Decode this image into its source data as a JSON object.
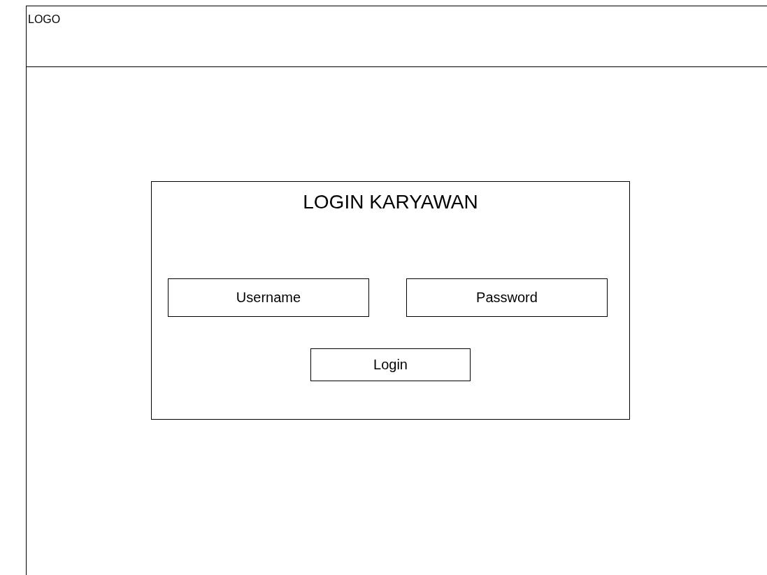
{
  "header": {
    "logo": "LOGO"
  },
  "login": {
    "title": "LOGIN KARYAWAN",
    "fields": [
      {
        "placeholder": "Username"
      },
      {
        "placeholder": "Password"
      }
    ],
    "button": "Login"
  }
}
